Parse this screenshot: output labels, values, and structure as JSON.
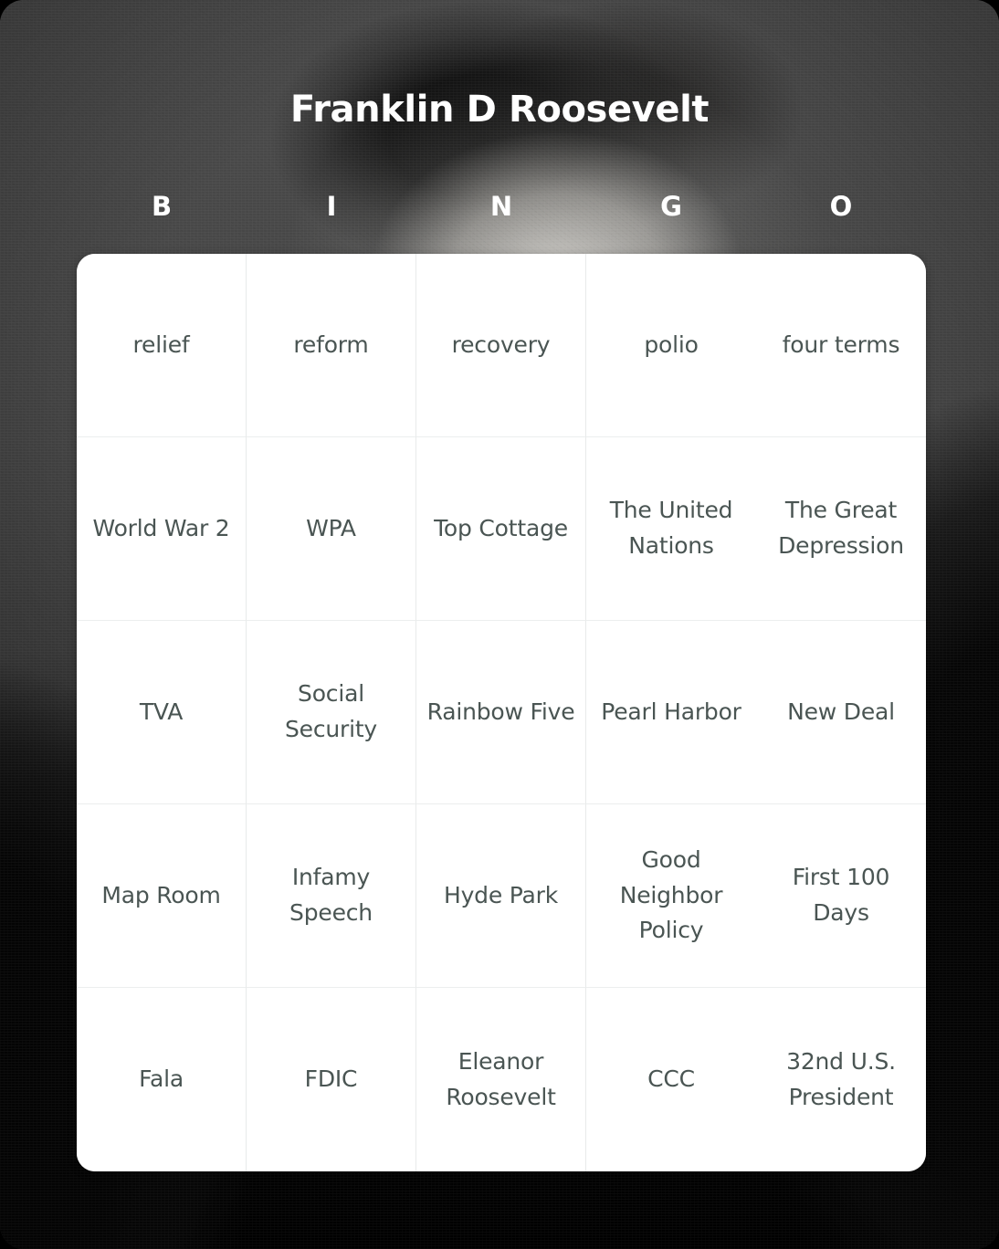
{
  "card": {
    "title": "Franklin D Roosevelt",
    "column_headers": [
      "B",
      "I",
      "N",
      "G",
      "O"
    ],
    "background": {
      "kind": "photo",
      "description": "black-and-white portrait photograph",
      "tone_light": "#d7d5d0",
      "tone_mid": "#454545",
      "tone_dark": "#050505"
    },
    "colors": {
      "title_text": "#ffffff",
      "header_text": "#ffffff",
      "cell_text": "#4a5553",
      "cell_background": "#ffffff",
      "cell_border": "#e8eaea",
      "page_background": "#000000"
    },
    "rows": [
      {
        "cells": [
          {
            "label": "relief"
          },
          {
            "label": "reform"
          },
          {
            "label": "recovery"
          },
          {
            "label": "polio"
          },
          {
            "label": "four terms"
          }
        ]
      },
      {
        "cells": [
          {
            "label": "World War 2"
          },
          {
            "label": "WPA"
          },
          {
            "label": "Top Cottage"
          },
          {
            "label": "The United Nations"
          },
          {
            "label": "The Great Depression"
          }
        ]
      },
      {
        "cells": [
          {
            "label": "TVA"
          },
          {
            "label": "Social Security"
          },
          {
            "label": "Rainbow Five"
          },
          {
            "label": "Pearl Harbor"
          },
          {
            "label": "New Deal"
          }
        ]
      },
      {
        "cells": [
          {
            "label": "Map Room"
          },
          {
            "label": "Infamy Speech"
          },
          {
            "label": "Hyde Park"
          },
          {
            "label": "Good Neighbor Policy"
          },
          {
            "label": "First 100 Days"
          }
        ]
      },
      {
        "cells": [
          {
            "label": "Fala"
          },
          {
            "label": "FDIC"
          },
          {
            "label": "Eleanor Roosevelt"
          },
          {
            "label": "CCC"
          },
          {
            "label": "32nd U.S. President"
          }
        ]
      }
    ]
  }
}
